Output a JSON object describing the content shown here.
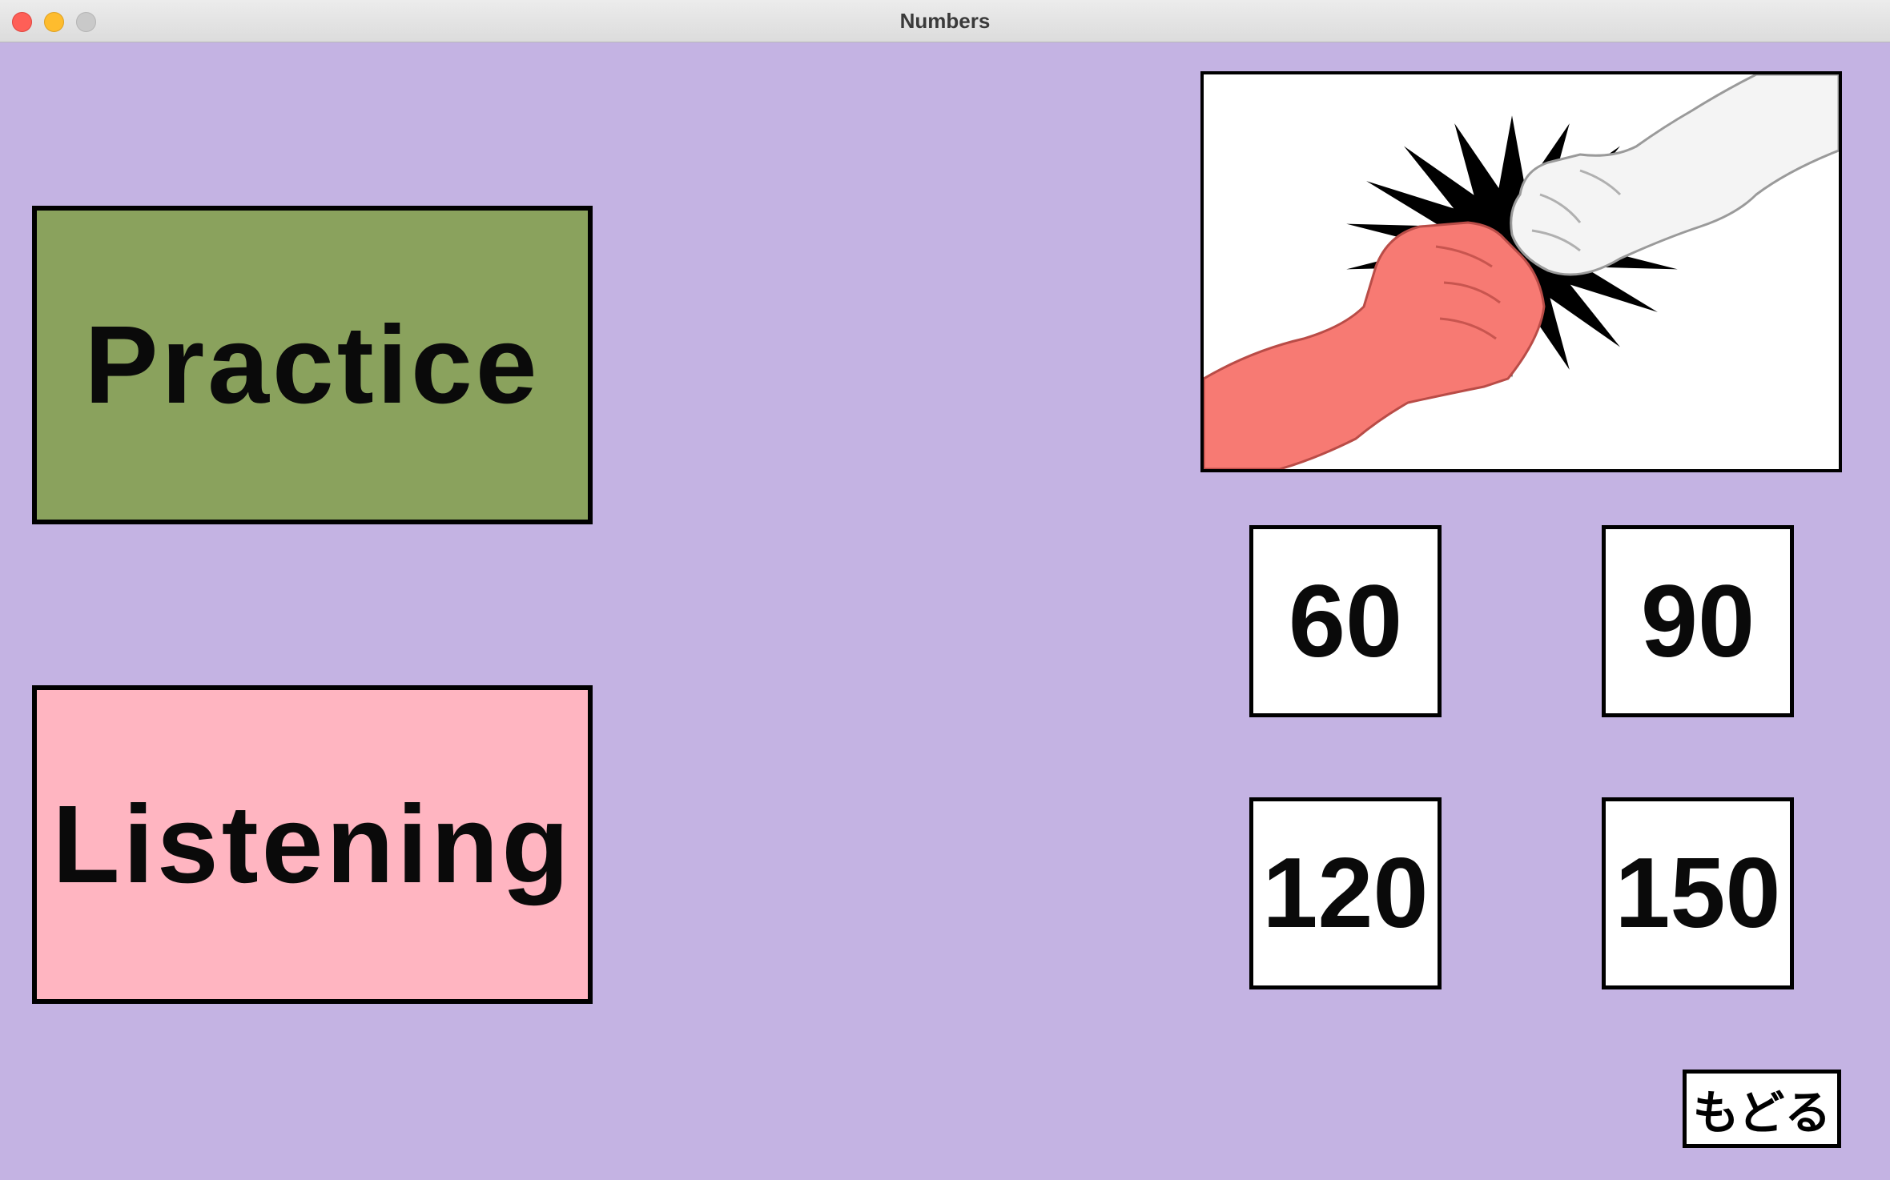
{
  "window": {
    "title": "Numbers"
  },
  "mode_buttons": {
    "practice_label": "Practice",
    "listening_label": "Listening"
  },
  "picture": {
    "icon": "fist-bump-illustration"
  },
  "answer_choices": [
    "60",
    "90",
    "120",
    "150"
  ],
  "back_button": {
    "label": "もどる"
  },
  "colors": {
    "background": "#c4b3e3",
    "practice": "#8aa25d",
    "listening": "#ffb5c1",
    "card": "#ffffff",
    "red_fist": "#f77a73"
  }
}
